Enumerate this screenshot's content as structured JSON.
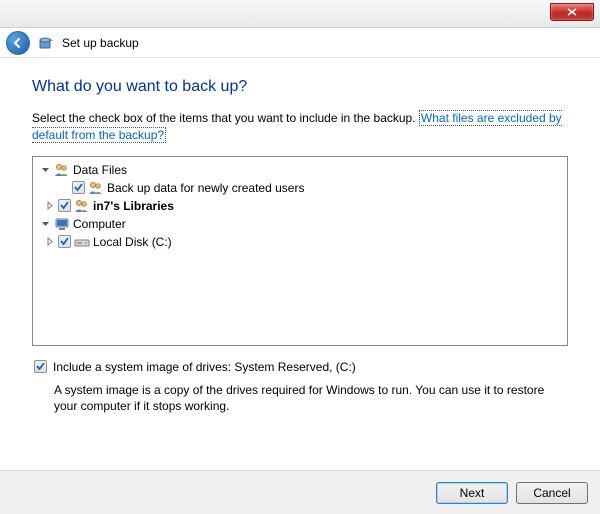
{
  "header": {
    "title": "Set up backup"
  },
  "main": {
    "heading": "What do you want to back up?",
    "instruction_prefix": "Select the check box of the items that you want to include in the backup. ",
    "help_link": "What files are excluded by default from the backup?"
  },
  "tree": {
    "data_files_label": "Data Files",
    "backup_new_users_label": "Back up data for newly created users",
    "user_libraries_label": "in7's Libraries",
    "computer_label": "Computer",
    "local_disk_label": "Local Disk (C:)"
  },
  "system_image": {
    "checkbox_label": "Include a system image of drives: System Reserved, (C:)",
    "description": "A system image is a copy of the drives required for Windows to run. You can use it to restore your computer if it stops working."
  },
  "buttons": {
    "next": "Next",
    "cancel": "Cancel"
  }
}
